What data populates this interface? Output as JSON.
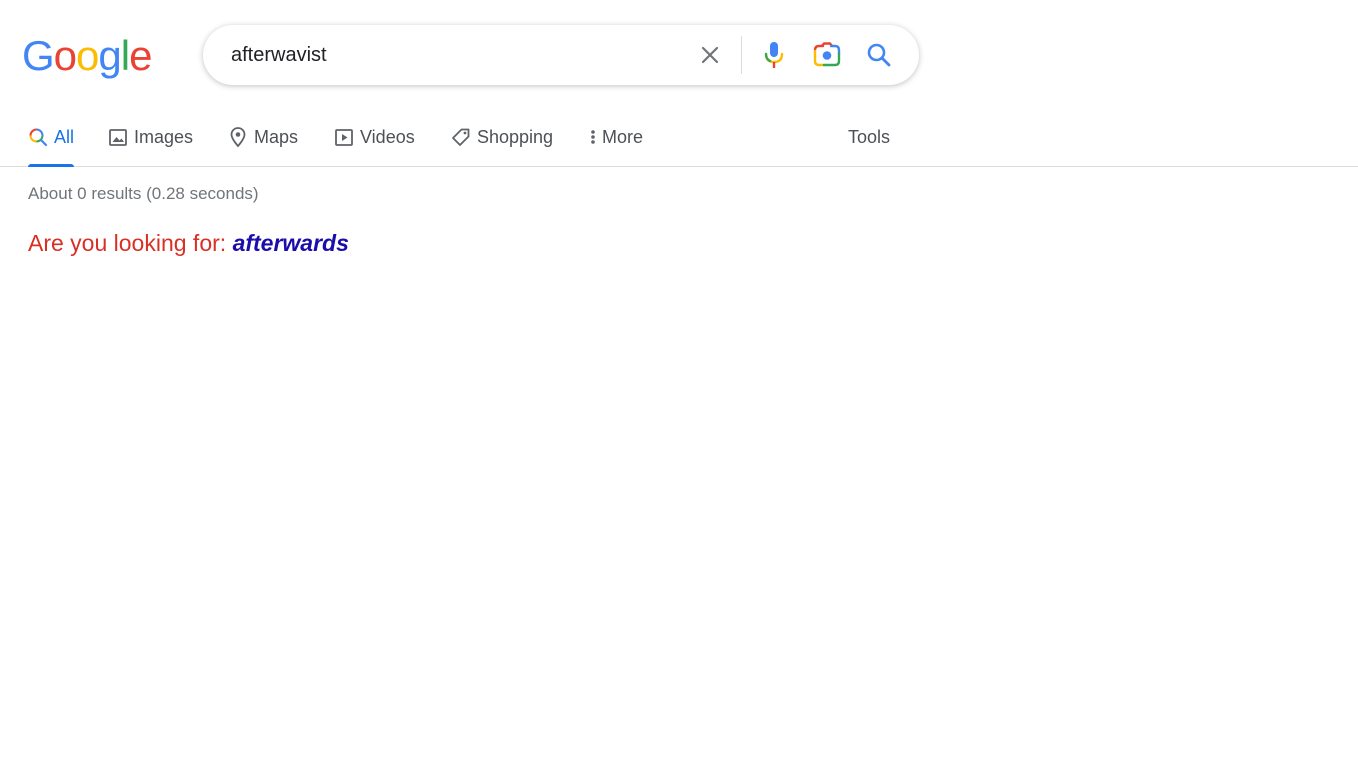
{
  "logo": {
    "letters": [
      "G",
      "o",
      "o",
      "g",
      "l",
      "e"
    ],
    "colors": [
      "#4285f4",
      "#ea4335",
      "#fbbc05",
      "#4285f4",
      "#34a853",
      "#ea4335"
    ]
  },
  "search": {
    "query": "afterwavist",
    "icons": [
      "close-icon",
      "microphone-icon",
      "camera-lens-icon",
      "search-icon"
    ]
  },
  "tabs": [
    {
      "label": "All",
      "icon": "search-icon",
      "active": true
    },
    {
      "label": "Images",
      "icon": "image-icon",
      "active": false
    },
    {
      "label": "Maps",
      "icon": "map-pin-icon",
      "active": false
    },
    {
      "label": "Videos",
      "icon": "play-icon",
      "active": false
    },
    {
      "label": "Shopping",
      "icon": "tag-icon",
      "active": false
    },
    {
      "label": "More",
      "icon": "more-vert-icon",
      "active": false
    }
  ],
  "tools_label": "Tools",
  "results": {
    "stats": "About 0 results (0.28 seconds)",
    "suggestion_prefix": "Are you looking for: ",
    "suggestion_term": "afterwards"
  },
  "colors": {
    "accent": "#1a73e8",
    "suggestion_prefix": "#d93025",
    "suggestion_link": "#1a0dab"
  }
}
